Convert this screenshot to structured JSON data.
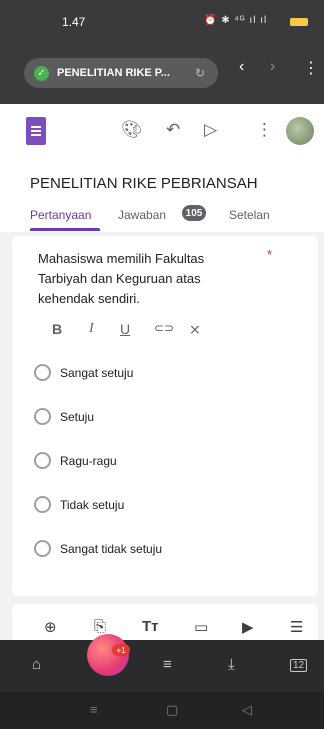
{
  "status_bar": {
    "time": "1.47",
    "system_icons": "⏰ ✱ ⁴ᴳ ıl ıl"
  },
  "browser": {
    "url_title": "PENELITIAN RIKE P...",
    "icons": [
      "shield-check-icon",
      "reload-icon",
      "back-icon",
      "forward-icon",
      "menu-icon"
    ]
  },
  "toolbar": {
    "icons": [
      "google-forms-icon",
      "palette-icon",
      "undo-icon",
      "send-icon",
      "more-icon",
      "avatar"
    ]
  },
  "form": {
    "title": "PENELITIAN RIKE PEBRIANSAH",
    "tabs": [
      {
        "label": "Pertanyaan"
      },
      {
        "label": "Jawaban"
      },
      {
        "label": "Setelan"
      }
    ],
    "responses_count": "105"
  },
  "question": {
    "text": "Mahasiswa memilih Fakultas Tarbiyah dan Keguruan  atas kehendak sendiri.",
    "required_mark": "*",
    "format": [
      "B",
      "I",
      "U",
      "🔗",
      "⨯"
    ],
    "options": [
      "Sangat setuju",
      "Setuju",
      "Ragu-ragu",
      "Tidak setuju",
      "Sangat tidak setuju"
    ]
  },
  "bottom_tools": [
    "add-question-icon",
    "import-icon",
    "title-text-icon",
    "image-icon",
    "video-icon",
    "section-icon"
  ],
  "app_bar": {
    "fab_badge": "+1",
    "tabs_count": "12"
  },
  "colors": {
    "accent": "#673ab7",
    "required": "#d93025",
    "secure": "#4caf50"
  }
}
